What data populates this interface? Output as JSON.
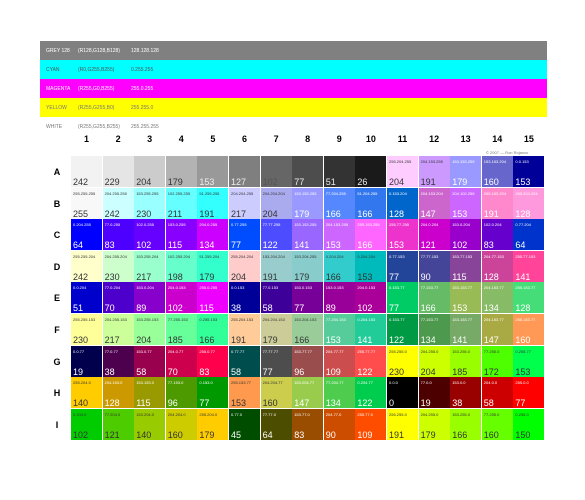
{
  "reference_colors": [
    {
      "name": "GREY 128",
      "formula": "(R128,G128,B128)",
      "hex": "128.128.128",
      "color": "#808080",
      "text_color": "#ffffff"
    },
    {
      "name": "CYAN",
      "formula": "(R0,G255,B255)",
      "hex": "0.255.255",
      "color": "#00ffff",
      "text_color": "#555555"
    },
    {
      "name": "MAGENTA",
      "formula": "(R255,G0,B255)",
      "hex": "255.0.255",
      "color": "#ff00ff",
      "text_color": "#ffffff"
    },
    {
      "name": "YELLOW",
      "formula": "(R255,G255,B0)",
      "hex": "255.255.0",
      "color": "#ffff00",
      "text_color": "#777777"
    },
    {
      "name": "WHITE",
      "formula": "(R255,G255,B255)",
      "hex": "255.255.255",
      "color": "#ffffff",
      "text_color": "#777777"
    }
  ],
  "columns": [
    "1",
    "2",
    "3",
    "4",
    "5",
    "6",
    "7",
    "8",
    "9",
    "10",
    "11",
    "12",
    "13",
    "14",
    "15"
  ],
  "rows": [
    {
      "label": "A",
      "cells": [
        {
          "code": "",
          "value": "242",
          "bg": "#f2f2f2",
          "fg": "#333"
        },
        {
          "code": "",
          "value": "229",
          "bg": "#e5e5e5",
          "fg": "#333"
        },
        {
          "code": "",
          "value": "204",
          "bg": "#cccccc",
          "fg": "#333"
        },
        {
          "code": "",
          "value": "179",
          "bg": "#b3b3b3",
          "fg": "#333"
        },
        {
          "code": "",
          "value": "153",
          "bg": "#999999",
          "fg": "#eee"
        },
        {
          "code": "",
          "value": "127",
          "bg": "#7f7f7f",
          "fg": "#eee"
        },
        {
          "code": "",
          "value": "102",
          "bg": "#666666",
          "fg": "#555"
        },
        {
          "code": "",
          "value": "77",
          "bg": "#4d4d4d",
          "fg": "#eee"
        },
        {
          "code": "",
          "value": "51",
          "bg": "#333333",
          "fg": "#eee"
        },
        {
          "code": "",
          "value": "26",
          "bg": "#1a1a1a",
          "fg": "#eee"
        },
        {
          "code": "255.204.255",
          "value": "204",
          "bg": "#ffccff",
          "fg": "#333"
        },
        {
          "code": "204.153.255",
          "value": "191",
          "bg": "#cc99ff",
          "fg": "#333"
        },
        {
          "code": "153.153.255",
          "value": "179",
          "bg": "#9999ff",
          "fg": "#fff"
        },
        {
          "code": "153.153.204",
          "value": "160",
          "bg": "#6666cc",
          "fg": "#fff"
        },
        {
          "code": "0.0.153",
          "value": "153",
          "bg": "#000099",
          "fg": "#fff"
        }
      ]
    },
    {
      "label": "B",
      "cells": [
        {
          "code": "255.255.255",
          "value": "255",
          "bg": "#f8f8f8",
          "fg": "#333"
        },
        {
          "code": "204.255.255",
          "value": "242",
          "bg": "#ccffff",
          "fg": "#333"
        },
        {
          "code": "153.255.255",
          "value": "230",
          "bg": "#99ffff",
          "fg": "#333"
        },
        {
          "code": "102.255.255",
          "value": "211",
          "bg": "#66ffff",
          "fg": "#333"
        },
        {
          "code": "51.255.255",
          "value": "191",
          "bg": "#33ffff",
          "fg": "#333"
        },
        {
          "code": "204.204.255",
          "value": "217",
          "bg": "#ccccff",
          "fg": "#333"
        },
        {
          "code": "204.204.204",
          "value": "204",
          "bg": "#aaaaee",
          "fg": "#333"
        },
        {
          "code": "153.153.255",
          "value": "179",
          "bg": "#9999ff",
          "fg": "#fff"
        },
        {
          "code": "77.204.255",
          "value": "166",
          "bg": "#5588ff",
          "fg": "#fff"
        },
        {
          "code": "51.204.255",
          "value": "166",
          "bg": "#3377ee",
          "fg": "#fff"
        },
        {
          "code": "0.153.204",
          "value": "128",
          "bg": "#0066cc",
          "fg": "#fff"
        },
        {
          "code": "204.153.204",
          "value": "147",
          "bg": "#cc66cc",
          "fg": "#fff"
        },
        {
          "code": "204.102.255",
          "value": "153",
          "bg": "#cc66ff",
          "fg": "#fff"
        },
        {
          "code": "255.153.204",
          "value": "191",
          "bg": "#ff88cc",
          "fg": "#fff"
        },
        {
          "code": "255.204.204",
          "value": "128",
          "bg": "#ff99dd",
          "fg": "#fff"
        }
      ]
    },
    {
      "label": "C",
      "cells": [
        {
          "code": "0.204.255",
          "value": "64",
          "bg": "#0000ff",
          "fg": "#fff"
        },
        {
          "code": "77.0.255",
          "value": "83",
          "bg": "#4d00ff",
          "fg": "#fff"
        },
        {
          "code": "102.0.255",
          "value": "102",
          "bg": "#6600ff",
          "fg": "#fff"
        },
        {
          "code": "153.0.255",
          "value": "115",
          "bg": "#8800ff",
          "fg": "#fff"
        },
        {
          "code": "204.0.255",
          "value": "134",
          "bg": "#cc00ff",
          "fg": "#fff"
        },
        {
          "code": "0.77.255",
          "value": "77",
          "bg": "#004dff",
          "fg": "#fff"
        },
        {
          "code": "77.77.255",
          "value": "122",
          "bg": "#4d4dff",
          "fg": "#fff"
        },
        {
          "code": "153.153.255",
          "value": "141",
          "bg": "#9966ff",
          "fg": "#fff"
        },
        {
          "code": "204.153.255",
          "value": "153",
          "bg": "#cc66ff",
          "fg": "#fff"
        },
        {
          "code": "255.153.255",
          "value": "166",
          "bg": "#ff66ff",
          "fg": "#fff"
        },
        {
          "code": "255.77.255",
          "value": "153",
          "bg": "#ee33cc",
          "fg": "#fff"
        },
        {
          "code": "204.0.204",
          "value": "121",
          "bg": "#cc00cc",
          "fg": "#fff"
        },
        {
          "code": "153.0.204",
          "value": "102",
          "bg": "#9900cc",
          "fg": "#fff"
        },
        {
          "code": "102.0.204",
          "value": "83",
          "bg": "#6600cc",
          "fg": "#fff"
        },
        {
          "code": "0.77.204",
          "value": "64",
          "bg": "#0033cc",
          "fg": "#fff"
        }
      ]
    },
    {
      "label": "D",
      "cells": [
        {
          "code": "255.255.204",
          "value": "242",
          "bg": "#ffffcc",
          "fg": "#333"
        },
        {
          "code": "204.255.204",
          "value": "230",
          "bg": "#ccffcc",
          "fg": "#333"
        },
        {
          "code": "153.255.204",
          "value": "217",
          "bg": "#99ffcc",
          "fg": "#333"
        },
        {
          "code": "102.255.204",
          "value": "198",
          "bg": "#66ffcc",
          "fg": "#333"
        },
        {
          "code": "51.255.204",
          "value": "179",
          "bg": "#33ffcc",
          "fg": "#333"
        },
        {
          "code": "255.204.204",
          "value": "204",
          "bg": "#ffcccc",
          "fg": "#333"
        },
        {
          "code": "153.204.204",
          "value": "191",
          "bg": "#99cccc",
          "fg": "#333"
        },
        {
          "code": "153.204.255",
          "value": "179",
          "bg": "#88cccc",
          "fg": "#333"
        },
        {
          "code": "0.204.204",
          "value": "166",
          "bg": "#33cccc",
          "fg": "#333"
        },
        {
          "code": "0.204.204",
          "value": "153",
          "bg": "#00bbbb",
          "fg": "#333"
        },
        {
          "code": "0.77.153",
          "value": "77",
          "bg": "#224499",
          "fg": "#fff"
        },
        {
          "code": "77.77.153",
          "value": "90",
          "bg": "#444499",
          "fg": "#fff"
        },
        {
          "code": "153.77.153",
          "value": "115",
          "bg": "#884499",
          "fg": "#fff"
        },
        {
          "code": "204.77.153",
          "value": "128",
          "bg": "#cc4499",
          "fg": "#fff"
        },
        {
          "code": "255.77.153",
          "value": "141",
          "bg": "#ff4499",
          "fg": "#fff"
        }
      ]
    },
    {
      "label": "E",
      "cells": [
        {
          "code": "0.0.204",
          "value": "51",
          "bg": "#0000cc",
          "fg": "#fff"
        },
        {
          "code": "77.0.204",
          "value": "70",
          "bg": "#4d00cc",
          "fg": "#fff"
        },
        {
          "code": "153.0.204",
          "value": "89",
          "bg": "#8800cc",
          "fg": "#fff"
        },
        {
          "code": "204.0.153",
          "value": "102",
          "bg": "#cc00cc",
          "fg": "#fff"
        },
        {
          "code": "255.0.255",
          "value": "115",
          "bg": "#ee00ff",
          "fg": "#fff"
        },
        {
          "code": "0.0.153",
          "value": "38",
          "bg": "#000099",
          "fg": "#fff"
        },
        {
          "code": "77.0.153",
          "value": "58",
          "bg": "#3d0099",
          "fg": "#fff"
        },
        {
          "code": "153.0.153",
          "value": "77",
          "bg": "#770099",
          "fg": "#fff"
        },
        {
          "code": "153.0.153",
          "value": "89",
          "bg": "#990099",
          "fg": "#fff"
        },
        {
          "code": "204.0.153",
          "value": "102",
          "bg": "#aa0099",
          "fg": "#fff"
        },
        {
          "code": "0.153.77",
          "value": "77",
          "bg": "#00cc66",
          "fg": "#fff"
        },
        {
          "code": "77.153.77",
          "value": "166",
          "bg": "#66bb66",
          "fg": "#fff"
        },
        {
          "code": "153.153.77",
          "value": "153",
          "bg": "#99bb55",
          "fg": "#fff"
        },
        {
          "code": "204.153.77",
          "value": "134",
          "bg": "#88bb66",
          "fg": "#fff"
        },
        {
          "code": "255.153.77",
          "value": "128",
          "bg": "#44dd77",
          "fg": "#fff"
        }
      ]
    },
    {
      "label": "F",
      "cells": [
        {
          "code": "255.255.153",
          "value": "230",
          "bg": "#ffff99",
          "fg": "#333"
        },
        {
          "code": "204.255.153",
          "value": "217",
          "bg": "#ccff99",
          "fg": "#333"
        },
        {
          "code": "153.255.153",
          "value": "204",
          "bg": "#99ff99",
          "fg": "#333"
        },
        {
          "code": "77.255.153",
          "value": "185",
          "bg": "#66ff99",
          "fg": "#333"
        },
        {
          "code": "0.255.153",
          "value": "166",
          "bg": "#33ff99",
          "fg": "#333"
        },
        {
          "code": "255.204.153",
          "value": "191",
          "bg": "#ffcc99",
          "fg": "#333"
        },
        {
          "code": "204.204.153",
          "value": "179",
          "bg": "#cccc99",
          "fg": "#333"
        },
        {
          "code": "153.204.153",
          "value": "166",
          "bg": "#99cc99",
          "fg": "#333"
        },
        {
          "code": "77.204.153",
          "value": "153",
          "bg": "#55cc99",
          "fg": "#fff"
        },
        {
          "code": "0.204.153",
          "value": "141",
          "bg": "#22cc99",
          "fg": "#fff"
        },
        {
          "code": "0.153.77",
          "value": "122",
          "bg": "#009944",
          "fg": "#fff"
        },
        {
          "code": "77.153.77",
          "value": "134",
          "bg": "#4d994d",
          "fg": "#fff"
        },
        {
          "code": "153.153.77",
          "value": "141",
          "bg": "#77aa66",
          "fg": "#fff"
        },
        {
          "code": "204.153.77",
          "value": "147",
          "bg": "#aaaa44",
          "fg": "#fff"
        },
        {
          "code": "255.153.77",
          "value": "160",
          "bg": "#ff9955",
          "fg": "#fff"
        }
      ]
    },
    {
      "label": "G",
      "cells": [
        {
          "code": "0.0.77",
          "value": "19",
          "bg": "#00004d",
          "fg": "#fff"
        },
        {
          "code": "77.0.77",
          "value": "38",
          "bg": "#4d004d",
          "fg": "#fff"
        },
        {
          "code": "153.0.77",
          "value": "58",
          "bg": "#99004d",
          "fg": "#fff"
        },
        {
          "code": "204.0.77",
          "value": "70",
          "bg": "#cc004d",
          "fg": "#fff"
        },
        {
          "code": "255.0.77",
          "value": "83",
          "bg": "#ff004d",
          "fg": "#fff"
        },
        {
          "code": "0.77.77",
          "value": "58",
          "bg": "#004d4d",
          "fg": "#fff"
        },
        {
          "code": "77.77.77",
          "value": "77",
          "bg": "#4d4d4d",
          "fg": "#fff"
        },
        {
          "code": "153.77.77",
          "value": "96",
          "bg": "#994d4d",
          "fg": "#fff"
        },
        {
          "code": "204.77.77",
          "value": "109",
          "bg": "#cc4d4d",
          "fg": "#fff"
        },
        {
          "code": "255.77.77",
          "value": "122",
          "bg": "#ff4d4d",
          "fg": "#fff"
        },
        {
          "code": "255.255.0",
          "value": "230",
          "bg": "#ffff00",
          "fg": "#333"
        },
        {
          "code": "204.255.0",
          "value": "204",
          "bg": "#ccff00",
          "fg": "#333"
        },
        {
          "code": "153.255.0",
          "value": "185",
          "bg": "#99ff00",
          "fg": "#333"
        },
        {
          "code": "77.255.0",
          "value": "172",
          "bg": "#4dff00",
          "fg": "#333"
        },
        {
          "code": "0.255.77",
          "value": "153",
          "bg": "#00ff4d",
          "fg": "#333"
        }
      ]
    },
    {
      "label": "H",
      "cells": [
        {
          "code": "255.204.0",
          "value": "140",
          "bg": "#ffcc00",
          "fg": "#333"
        },
        {
          "code": "204.153.0",
          "value": "128",
          "bg": "#cc9900",
          "fg": "#fff"
        },
        {
          "code": "153.153.0",
          "value": "115",
          "bg": "#999900",
          "fg": "#fff"
        },
        {
          "code": "77.153.0",
          "value": "96",
          "bg": "#4d9900",
          "fg": "#fff"
        },
        {
          "code": "0.153.0",
          "value": "77",
          "bg": "#009900",
          "fg": "#fff"
        },
        {
          "code": "255.153.77",
          "value": "153",
          "bg": "#ff994d",
          "fg": "#333"
        },
        {
          "code": "204.204.77",
          "value": "160",
          "bg": "#cccc4d",
          "fg": "#333"
        },
        {
          "code": "153.204.77",
          "value": "147",
          "bg": "#99cc4d",
          "fg": "#fff"
        },
        {
          "code": "77.204.77",
          "value": "134",
          "bg": "#4dcc4d",
          "fg": "#fff"
        },
        {
          "code": "0.204.77",
          "value": "122",
          "bg": "#00cc4d",
          "fg": "#fff"
        },
        {
          "code": "0.0.0",
          "value": "0",
          "bg": "#000000",
          "fg": "#fff"
        },
        {
          "code": "77.0.0",
          "value": "19",
          "bg": "#4d0000",
          "fg": "#fff"
        },
        {
          "code": "153.0.0",
          "value": "38",
          "bg": "#990000",
          "fg": "#fff"
        },
        {
          "code": "204.0.0",
          "value": "58",
          "bg": "#cc0000",
          "fg": "#fff"
        },
        {
          "code": "255.0.0",
          "value": "77",
          "bg": "#ff0000",
          "fg": "#fff"
        }
      ]
    },
    {
      "label": "I",
      "cells": [
        {
          "code": "0.204.0",
          "value": "102",
          "bg": "#00cc00",
          "fg": "#333"
        },
        {
          "code": "77.204.0",
          "value": "121",
          "bg": "#4dcc00",
          "fg": "#333"
        },
        {
          "code": "153.204.0",
          "value": "140",
          "bg": "#99cc00",
          "fg": "#333"
        },
        {
          "code": "204.204.0",
          "value": "160",
          "bg": "#cccc00",
          "fg": "#333"
        },
        {
          "code": "255.204.0",
          "value": "179",
          "bg": "#ffcc00",
          "fg": "#333"
        },
        {
          "code": "0.77.0",
          "value": "45",
          "bg": "#004d00",
          "fg": "#fff"
        },
        {
          "code": "77.77.0",
          "value": "64",
          "bg": "#4d4d00",
          "fg": "#fff"
        },
        {
          "code": "153.77.0",
          "value": "83",
          "bg": "#994d00",
          "fg": "#fff"
        },
        {
          "code": "204.77.0",
          "value": "90",
          "bg": "#cc4d00",
          "fg": "#fff"
        },
        {
          "code": "255.77.0",
          "value": "109",
          "bg": "#ff4d00",
          "fg": "#fff"
        },
        {
          "code": "255.255.0",
          "value": "191",
          "bg": "#ffff00",
          "fg": "#333"
        },
        {
          "code": "204.255.0",
          "value": "179",
          "bg": "#ccff00",
          "fg": "#333"
        },
        {
          "code": "153.255.0",
          "value": "166",
          "bg": "#99ff00",
          "fg": "#333"
        },
        {
          "code": "77.255.0",
          "value": "160",
          "bg": "#66ff00",
          "fg": "#333"
        },
        {
          "code": "0.255.0",
          "value": "150",
          "bg": "#00ff00",
          "fg": "#333"
        }
      ]
    }
  ],
  "copyright": "© 2007 — Ron Rojanov"
}
